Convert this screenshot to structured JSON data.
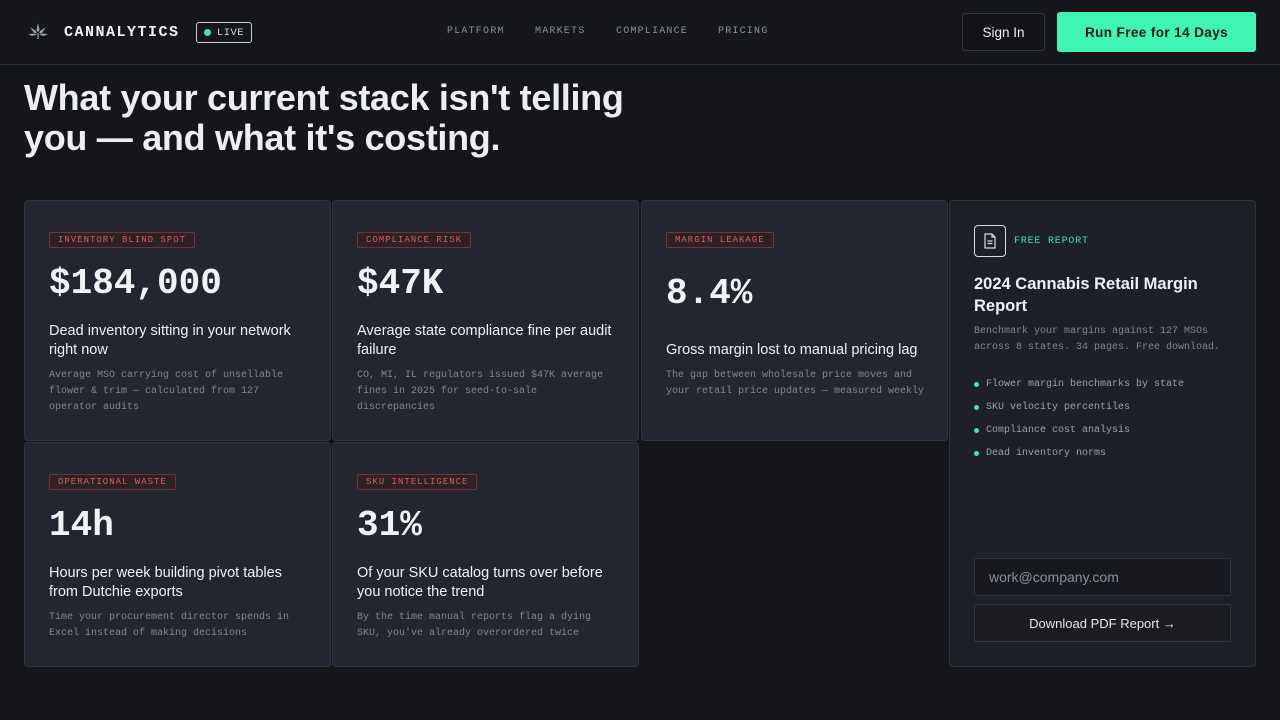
{
  "header": {
    "brand": "CANNALYTICS",
    "live_label": "LIVE",
    "nav": [
      "PLATFORM",
      "MARKETS",
      "COMPLIANCE",
      "PRICING"
    ],
    "signin_label": "Sign In",
    "cta_label": "Run Free for 14 Days",
    "accent_color": "#3ff5b4"
  },
  "headline": {
    "line1": "What your current stack isn't telling",
    "line2": "you — and what it's costing."
  },
  "cards": [
    {
      "tag": "INVENTORY BLIND SPOT",
      "stat": "$184,000",
      "title": "Dead inventory sitting in your network right now",
      "desc": "Average MSO carrying cost of unsellable flower & trim — calculated from 127 operator audits"
    },
    {
      "tag": "COMPLIANCE RISK",
      "stat": "$47K",
      "title": "Average state compliance fine per audit failure",
      "desc": "CO, MI, IL regulators issued $47K average fines in 2025 for seed-to-sale discrepancies"
    },
    {
      "tag": "MARGIN LEAKAGE",
      "stat": "8.4%",
      "title": "Gross margin lost to manual pricing lag",
      "desc": "The gap between wholesale price moves and your retail price updates — measured weekly"
    },
    {
      "tag": "OPERATIONAL WASTE",
      "stat": "14h",
      "title": "Hours per week building pivot tables from Dutchie exports",
      "desc": "Time your procurement director spends in Excel instead of making decisions"
    },
    {
      "tag": "SKU INTELLIGENCE",
      "stat": "31%",
      "title": "Of your SKU catalog turns over before you notice the trend",
      "desc": "By the time manual reports flag a dying SKU, you've already overordered twice"
    }
  ],
  "report": {
    "label": "FREE REPORT",
    "title": "2024 Cannabis Retail Margin Report",
    "desc": "Benchmark your margins against 127 MSOs across 8 states. 34 pages. Free download.",
    "bullets": [
      "Flower margin benchmarks by state",
      "SKU velocity percentiles",
      "Compliance cost analysis",
      "Dead inventory norms"
    ],
    "email_placeholder": "work@company.com",
    "download_label": "Download PDF Report →",
    "icon": "document-icon"
  },
  "colors": {
    "background": "#14161a",
    "card": "#23262e",
    "tag_red": "#d65a60",
    "green": "#3ee6b0"
  }
}
